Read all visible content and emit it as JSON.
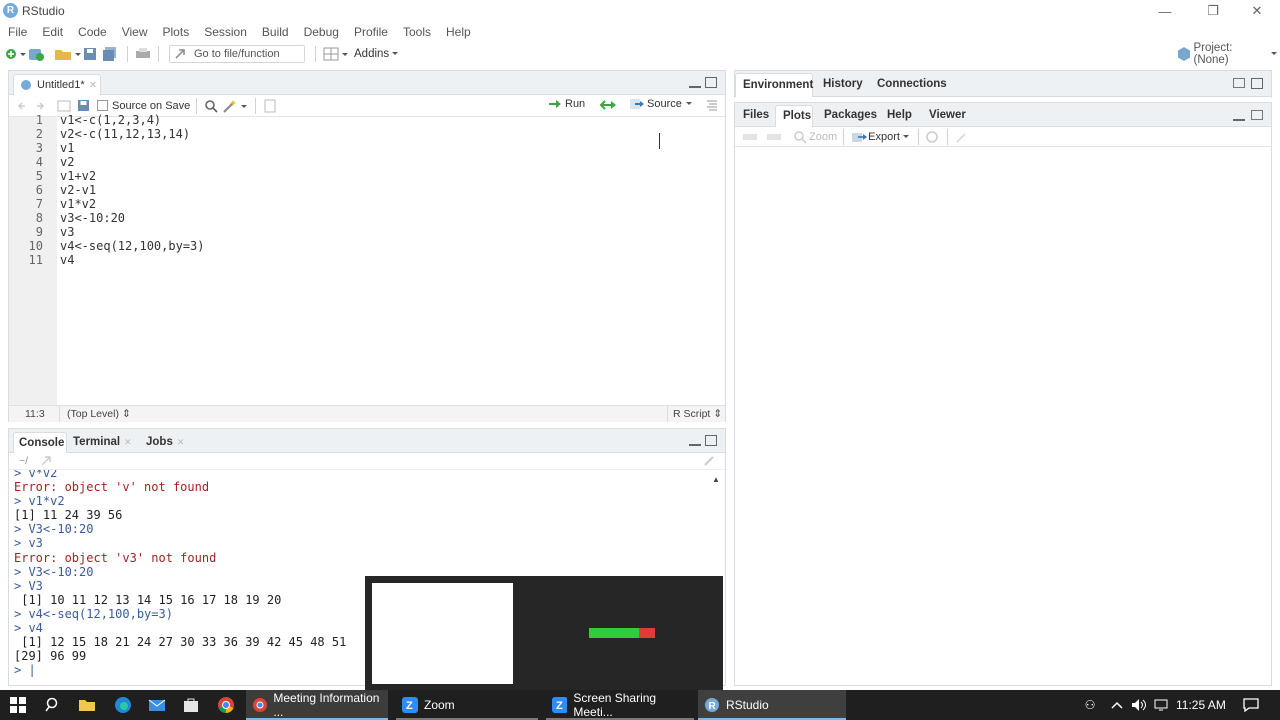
{
  "window": {
    "title": "RStudio",
    "logo_letter": "R"
  },
  "menu": [
    "File",
    "Edit",
    "Code",
    "View",
    "Plots",
    "Session",
    "Build",
    "Debug",
    "Profile",
    "Tools",
    "Help"
  ],
  "toolbar": {
    "goto_placeholder": "Go to file/function",
    "addins_label": "Addins",
    "project_label": "Project: (None)"
  },
  "editor": {
    "tab_label": "Untitled1*",
    "source_on_save": "Source on Save",
    "run_label": "Run",
    "source_label": "Source",
    "lines": [
      {
        "n": "1",
        "text": "v1<-c(1,2,3,4)"
      },
      {
        "n": "2",
        "text": "v2<-c(11,12,13,14)"
      },
      {
        "n": "3",
        "text": "v1"
      },
      {
        "n": "4",
        "text": "v2"
      },
      {
        "n": "5",
        "text": "v1+v2"
      },
      {
        "n": "6",
        "text": "v2-v1"
      },
      {
        "n": "7",
        "text": "v1*v2"
      },
      {
        "n": "8",
        "text": "v3<-10:20"
      },
      {
        "n": "9",
        "text": "v3"
      },
      {
        "n": "10",
        "text": "v4<-seq(12,100,by=3)"
      },
      {
        "n": "11",
        "text": "v4"
      }
    ],
    "status_position": "11:3",
    "status_scope": "(Top Level)",
    "status_type": "R Script"
  },
  "console": {
    "tabs": [
      "Console",
      "Terminal",
      "Jobs"
    ],
    "path": "~/",
    "lines": [
      {
        "kind": "cmd",
        "text": "> v*v2"
      },
      {
        "kind": "err",
        "text": "Error: object 'v' not found"
      },
      {
        "kind": "cmd",
        "text": "> v1*v2"
      },
      {
        "kind": "out",
        "text": "[1] 11 24 39 56"
      },
      {
        "kind": "cmd",
        "text": "> V3<-10:20"
      },
      {
        "kind": "cmd",
        "text": "> v3"
      },
      {
        "kind": "err",
        "text": "Error: object 'v3' not found"
      },
      {
        "kind": "cmd",
        "text": "> V3<-10:20"
      },
      {
        "kind": "cmd",
        "text": "> V3"
      },
      {
        "kind": "out",
        "text": " [1] 10 11 12 13 14 15 16 17 18 19 20"
      },
      {
        "kind": "cmd",
        "text": "> v4<-seq(12,100,by=3)"
      },
      {
        "kind": "cmd",
        "text": "> v4"
      },
      {
        "kind": "out",
        "text": " [1] 12 15 18 21 24 27 30 33 36 39 42 45 48 51"
      },
      {
        "kind": "out",
        "text": "[29] 96 99"
      },
      {
        "kind": "cmd",
        "text": "> |"
      }
    ]
  },
  "env_pane": {
    "tabs": [
      "Environment",
      "History",
      "Connections"
    ]
  },
  "files_pane": {
    "tabs": [
      "Files",
      "Plots",
      "Packages",
      "Help",
      "Viewer"
    ],
    "active_tab": "Plots",
    "zoom_label": "Zoom",
    "export_label": "Export"
  },
  "taskbar": {
    "items": [
      {
        "label": "Meeting Information ..."
      },
      {
        "label": "Zoom"
      },
      {
        "label": "Screen Sharing Meeti..."
      },
      {
        "label": "RStudio"
      }
    ],
    "time": "11:25 AM"
  },
  "colors": {
    "accent": "#75aadb",
    "error": "#a22424",
    "command": "#3a5b9a",
    "green_bar": "#2ecc40",
    "red_bar": "#e53935"
  }
}
